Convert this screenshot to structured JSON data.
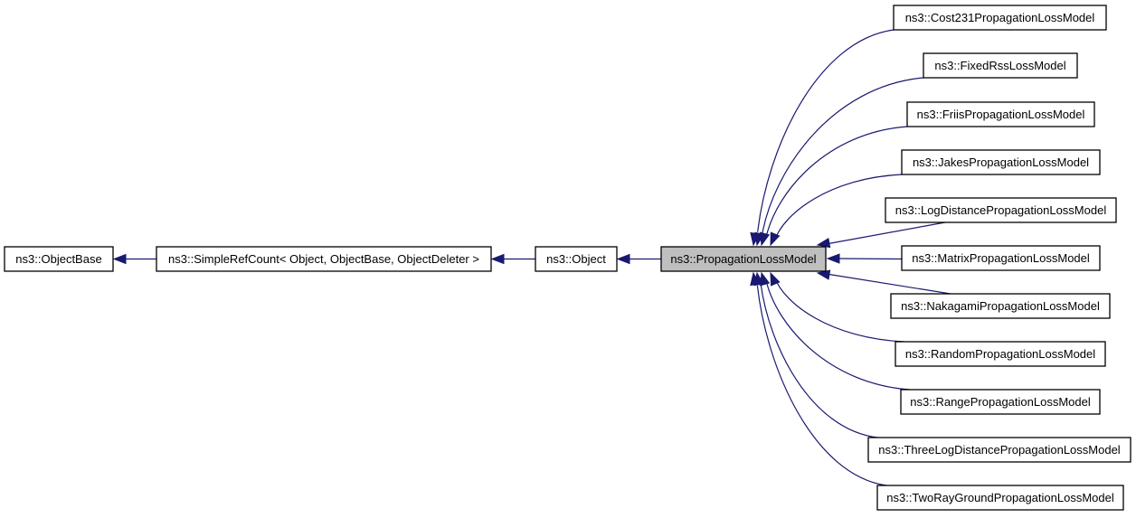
{
  "diagram": {
    "type": "class-inheritance-graph",
    "edge_color": "#191970",
    "current_node_fill": "#bfbfbf",
    "nodes": [
      {
        "id": "objectbase",
        "label": "ns3::ObjectBase",
        "current": false
      },
      {
        "id": "simplerefcount",
        "label": "ns3::SimpleRefCount< Object, ObjectBase, ObjectDeleter >",
        "current": false
      },
      {
        "id": "object",
        "label": "ns3::Object",
        "current": false
      },
      {
        "id": "propagationlossmodel",
        "label": "ns3::PropagationLossModel",
        "current": true
      },
      {
        "id": "cost231",
        "label": "ns3::Cost231PropagationLossModel",
        "current": false
      },
      {
        "id": "fixedrss",
        "label": "ns3::FixedRssLossModel",
        "current": false
      },
      {
        "id": "friis",
        "label": "ns3::FriisPropagationLossModel",
        "current": false
      },
      {
        "id": "jakes",
        "label": "ns3::JakesPropagationLossModel",
        "current": false
      },
      {
        "id": "logdistance",
        "label": "ns3::LogDistancePropagationLossModel",
        "current": false
      },
      {
        "id": "matrix",
        "label": "ns3::MatrixPropagationLossModel",
        "current": false
      },
      {
        "id": "nakagami",
        "label": "ns3::NakagamiPropagationLossModel",
        "current": false
      },
      {
        "id": "random",
        "label": "ns3::RandomPropagationLossModel",
        "current": false
      },
      {
        "id": "range",
        "label": "ns3::RangePropagationLossModel",
        "current": false
      },
      {
        "id": "threelogdistance",
        "label": "ns3::ThreeLogDistancePropagationLossModel",
        "current": false
      },
      {
        "id": "tworayground",
        "label": "ns3::TwoRayGroundPropagationLossModel",
        "current": false
      }
    ],
    "edges": [
      {
        "from": "simplerefcount",
        "to": "objectbase"
      },
      {
        "from": "object",
        "to": "simplerefcount"
      },
      {
        "from": "propagationlossmodel",
        "to": "object"
      },
      {
        "from": "cost231",
        "to": "propagationlossmodel"
      },
      {
        "from": "fixedrss",
        "to": "propagationlossmodel"
      },
      {
        "from": "friis",
        "to": "propagationlossmodel"
      },
      {
        "from": "jakes",
        "to": "propagationlossmodel"
      },
      {
        "from": "logdistance",
        "to": "propagationlossmodel"
      },
      {
        "from": "matrix",
        "to": "propagationlossmodel"
      },
      {
        "from": "nakagami",
        "to": "propagationlossmodel"
      },
      {
        "from": "random",
        "to": "propagationlossmodel"
      },
      {
        "from": "range",
        "to": "propagationlossmodel"
      },
      {
        "from": "threelogdistance",
        "to": "propagationlossmodel"
      },
      {
        "from": "tworayground",
        "to": "propagationlossmodel"
      }
    ]
  }
}
